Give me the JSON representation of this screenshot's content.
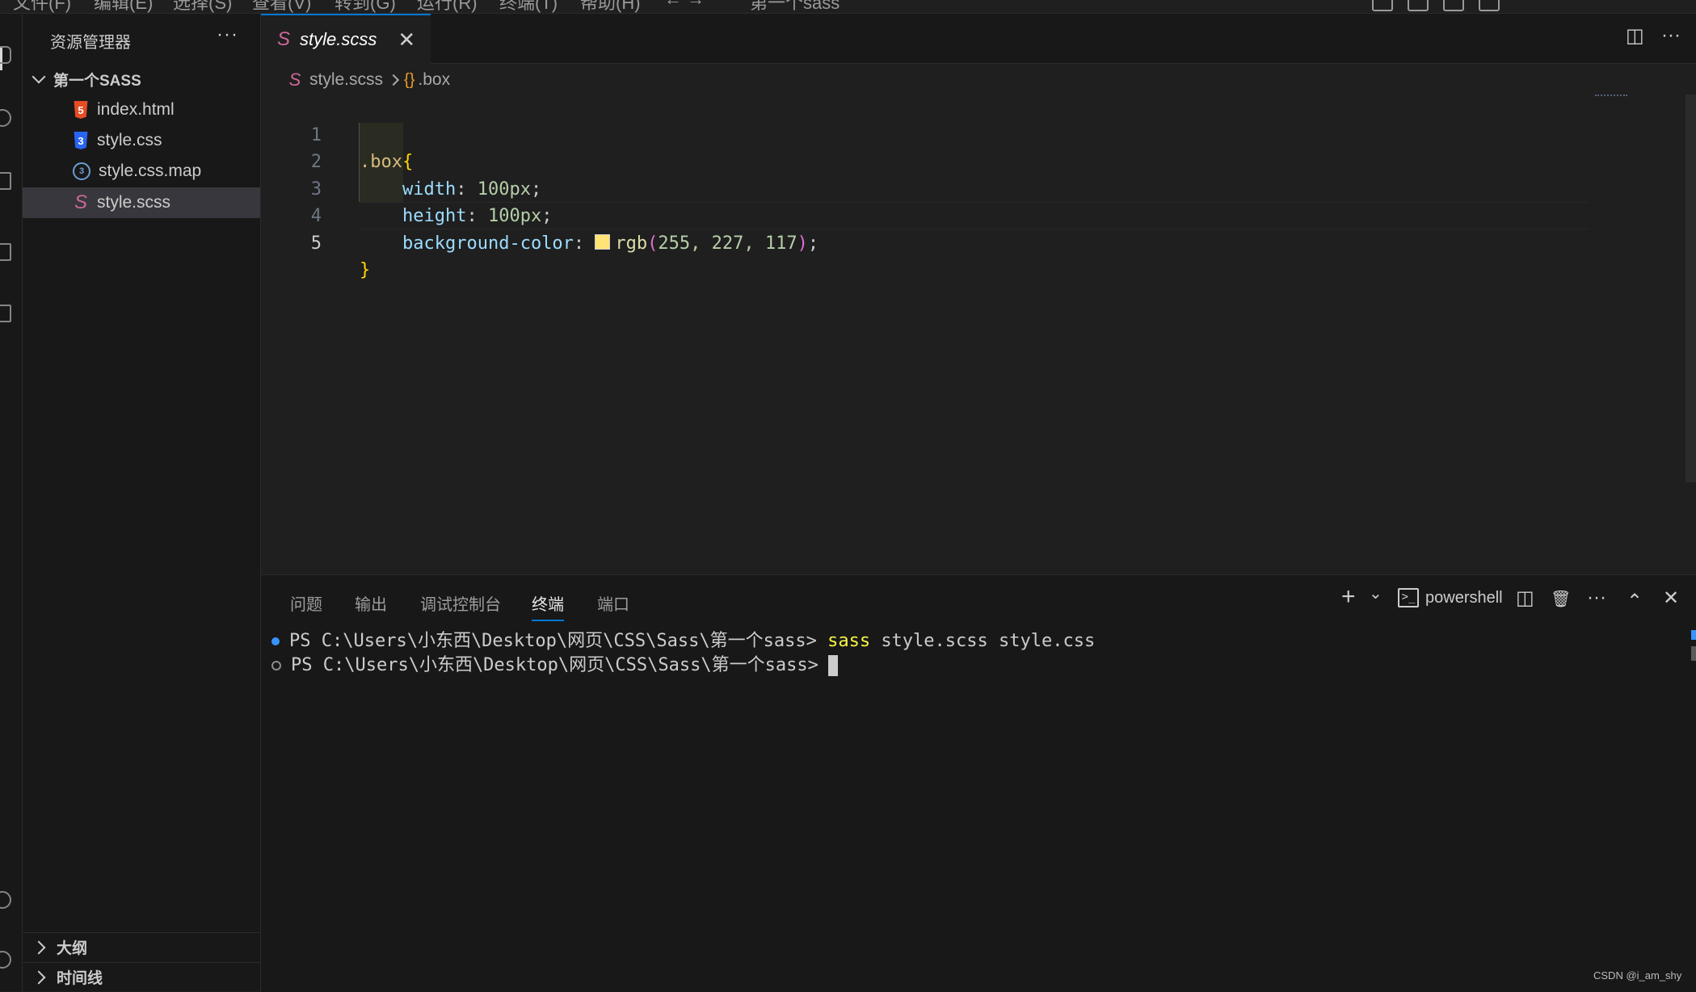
{
  "menubar": {
    "items": [
      "文件(F)",
      "编辑(E)",
      "选择(S)",
      "查看(V)",
      "转到(G)",
      "运行(R)",
      "终端(T)",
      "帮助(H)",
      "← →",
      "第一个sass"
    ]
  },
  "sidebar": {
    "title": "资源管理器",
    "more": "···",
    "folder": "第一个SASS",
    "files": [
      {
        "name": "index.html",
        "icon": "html5-icon",
        "icon_text": "5"
      },
      {
        "name": "style.css",
        "icon": "css3-icon",
        "icon_text": "3"
      },
      {
        "name": "style.css.map",
        "icon": "map-file-icon",
        "icon_text": "3"
      },
      {
        "name": "style.scss",
        "icon": "sass-icon",
        "icon_text": "S"
      }
    ],
    "sections": [
      "大纲",
      "时间线"
    ]
  },
  "editor": {
    "tab": {
      "label": "style.scss",
      "close": "✕"
    },
    "actions": {
      "split": "◫",
      "more": "···"
    },
    "breadcrumb": {
      "file": "style.scss",
      "symbol": ".box",
      "symbol_icon": "{}"
    },
    "line_numbers": [
      "1",
      "2",
      "3",
      "4",
      "5"
    ],
    "code": {
      "selector": ".box",
      "open_brace": "{",
      "close_brace": "}",
      "width_prop": "width",
      "width_val": "100px",
      "height_prop": "height",
      "height_val": "100px",
      "bg_prop": "background-color",
      "bg_fn": "rgb",
      "bg_args": "255, 227, 117",
      "colon": ":",
      "semicolon": ";",
      "open_paren": "(",
      "close_paren": ")",
      "swatch_color": "#ffe375"
    }
  },
  "panel": {
    "tabs": [
      "问题",
      "输出",
      "调试控制台",
      "终端",
      "端口"
    ],
    "active_tab": "终端",
    "profile": "powershell",
    "profile_icon": ">_",
    "actions": {
      "add": "+",
      "dropdown": "⌄",
      "split": "◫",
      "trash": "🗑",
      "more": "···",
      "maximize": "⌃",
      "close": "✕"
    }
  },
  "terminal": {
    "lines": [
      {
        "prompt": "PS C:\\Users\\小东西\\Desktop\\网页\\CSS\\Sass\\第一个sass>",
        "command": "sass",
        "args": "style.scss style.css"
      },
      {
        "prompt": "PS C:\\Users\\小东西\\Desktop\\网页\\CSS\\Sass\\第一个sass>",
        "command": "",
        "args": ""
      }
    ]
  },
  "watermark": "CSDN @i_am_shy",
  "colors": {
    "accent": "#0078d4",
    "editor_bg": "#1f1f1f",
    "sidebar_bg": "#181818",
    "selection": "#37373d"
  }
}
